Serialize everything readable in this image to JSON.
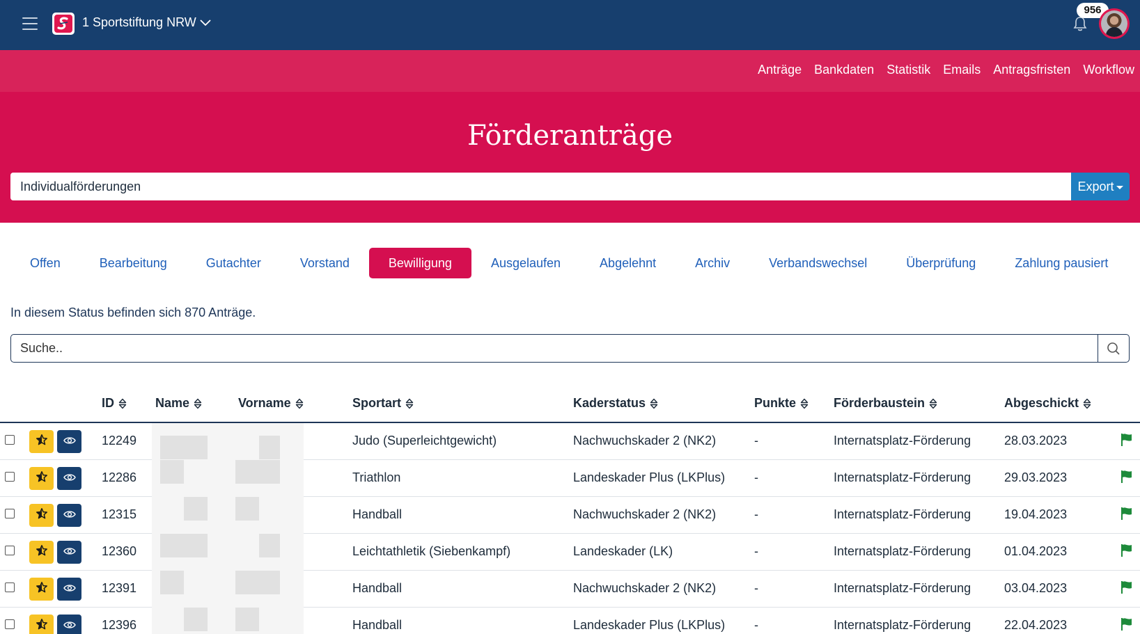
{
  "topbar": {
    "org_name": "1 Sportstiftung NRW",
    "notification_count": "956",
    "colors": {
      "navy": "#173f6e",
      "pink": "#d50f50"
    }
  },
  "subnav": {
    "links": [
      "Anträge",
      "Bankdaten",
      "Statistik",
      "Emails",
      "Antragsfristen",
      "Workflow"
    ]
  },
  "hero": {
    "title": "Förderanträge",
    "selected_program": "Individualförderungen",
    "export_label": "Export"
  },
  "tabs": [
    "Offen",
    "Bearbeitung",
    "Gutachter",
    "Vorstand",
    "Bewilligung",
    "Ausgelaufen",
    "Abgelehnt",
    "Archiv",
    "Verbandswechsel",
    "Überprüfung",
    "Zahlung pausiert"
  ],
  "active_tab": "Bewilligung",
  "status_text": "In diesem Status befinden sich 870 Anträge.",
  "search": {
    "placeholder": "Suche.."
  },
  "table": {
    "columns": [
      "ID",
      "Name",
      "Vorname",
      "Sportart",
      "Kaderstatus",
      "Punkte",
      "Förderbaustein",
      "Abgeschickt"
    ],
    "rows": [
      {
        "id": "12249",
        "sportart": "Judo (Superleichtgewicht)",
        "kaderstatus": "Nachwuchskader 2 (NK2)",
        "punkte": "-",
        "foerderbaustein": "Internatsplatz-Förderung",
        "abgeschickt": "28.03.2023"
      },
      {
        "id": "12286",
        "sportart": "Triathlon",
        "kaderstatus": "Landeskader Plus (LKPlus)",
        "punkte": "-",
        "foerderbaustein": "Internatsplatz-Förderung",
        "abgeschickt": "29.03.2023"
      },
      {
        "id": "12315",
        "sportart": "Handball",
        "kaderstatus": "Nachwuchskader 2 (NK2)",
        "punkte": "-",
        "foerderbaustein": "Internatsplatz-Förderung",
        "abgeschickt": "19.04.2023"
      },
      {
        "id": "12360",
        "sportart": "Leichtathletik (Siebenkampf)",
        "kaderstatus": "Landeskader (LK)",
        "punkte": "-",
        "foerderbaustein": "Internatsplatz-Förderung",
        "abgeschickt": "01.04.2023"
      },
      {
        "id": "12391",
        "sportart": "Handball",
        "kaderstatus": "Nachwuchskader 2 (NK2)",
        "punkte": "-",
        "foerderbaustein": "Internatsplatz-Förderung",
        "abgeschickt": "03.04.2023"
      },
      {
        "id": "12396",
        "sportart": "Handball",
        "kaderstatus": "Landeskader Plus (LKPlus)",
        "punkte": "-",
        "foerderbaustein": "Internatsplatz-Förderung",
        "abgeschickt": "22.04.2023"
      }
    ]
  },
  "icons": {
    "menu": "hamburger-icon",
    "logo": "sportstiftung-logo",
    "chevron": "chevron-down-icon",
    "bell": "bell-icon",
    "search": "search-icon",
    "star": "star-icon",
    "eye": "eye-icon",
    "flag": "flag-icon",
    "sort": "sort-icon"
  }
}
